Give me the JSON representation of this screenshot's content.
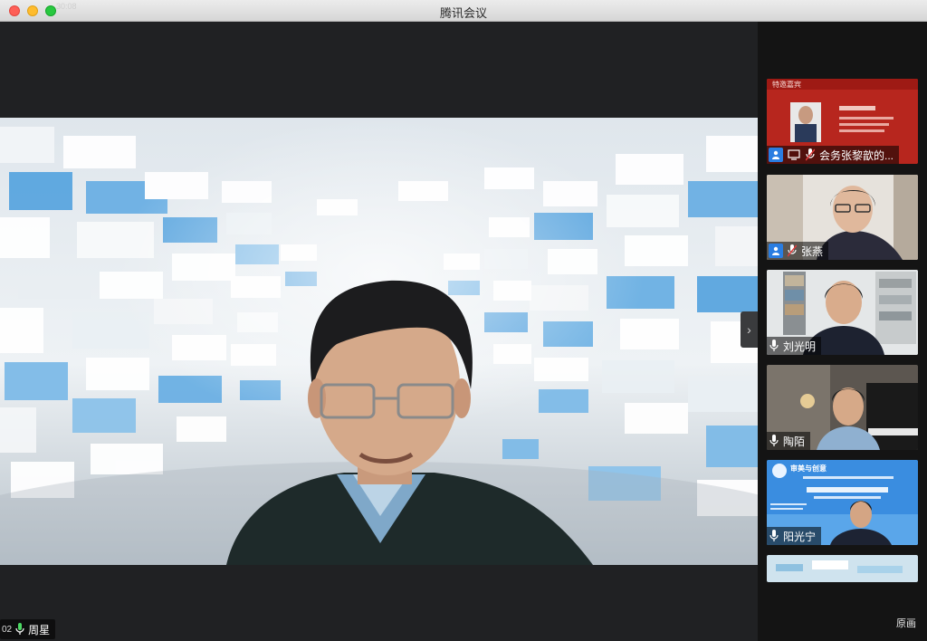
{
  "window": {
    "title": "腾讯会议",
    "ghost_text": "30:08"
  },
  "main_video": {
    "speaker_name": "周星",
    "timer_prefix": "02"
  },
  "participants": [
    {
      "name": "会务张黎歆的...",
      "type": "screen-share",
      "slide_header": "特邀嘉宾",
      "slide_name": "..."
    },
    {
      "name": "张燕",
      "type": "camera"
    },
    {
      "name": "刘光明",
      "type": "camera"
    },
    {
      "name": "陶陌",
      "type": "camera"
    },
    {
      "name": "阳光宁",
      "type": "camera",
      "poster_title": "审美与创意"
    },
    {
      "name": "",
      "type": "camera"
    }
  ],
  "controls": {
    "original_label": "原画",
    "expand_arrow": "›"
  },
  "colors": {
    "accent": "#2a7de1",
    "title_bar": "#e3e3e3",
    "panel_bg": "#141414"
  }
}
